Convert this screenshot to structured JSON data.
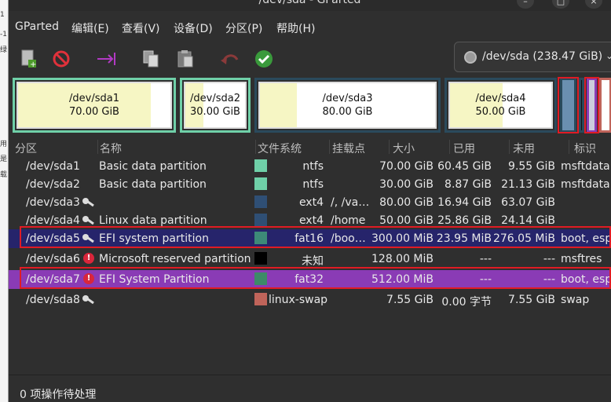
{
  "window": {
    "title": "/dev/sda - GParted"
  },
  "left_strip": [
    "1",
    "-1",
    "绿",
    "用",
    "是",
    "载"
  ],
  "menu": [
    "GParted",
    "编辑(E)",
    "查看(V)",
    "设备(D)",
    "分区(P)",
    "帮助(H)"
  ],
  "toolbar": {
    "buttons": [
      "new-icon",
      "delete-icon",
      "resize-move-icon",
      "copy-icon",
      "paste-icon",
      "undo-icon",
      "apply-icon"
    ]
  },
  "device": {
    "label": "/dev/sda  (238.47 GiB)"
  },
  "diskmap": [
    {
      "name": "/dev/sda1",
      "size": "70.00 GiB",
      "used_fraction": 0.87
    },
    {
      "name": "/dev/sda2",
      "size": "30.00 GiB",
      "used_fraction": 0.3
    },
    {
      "name": "/dev/sda3",
      "size": "80.00 GiB",
      "used_fraction": 0.21
    },
    {
      "name": "/dev/sda4",
      "size": "50.00 GiB",
      "used_fraction": 0.52
    }
  ],
  "columns": [
    "分区",
    "名称",
    "文件系统",
    "挂载点",
    "大小",
    "已用",
    "未用",
    "标识"
  ],
  "partitions": [
    {
      "partition": "/dev/sda1",
      "name": "Basic data partition",
      "fs": "ntfs",
      "fs_color": "#6fd0a8",
      "mount": "",
      "size": "70.00 GiB",
      "used": "60.45 GiB",
      "unused": "9.55 GiB",
      "flags": "msftdata",
      "icon": ""
    },
    {
      "partition": "/dev/sda2",
      "name": "Basic data partition",
      "fs": "ntfs",
      "fs_color": "#6fd0a8",
      "mount": "",
      "size": "30.00 GiB",
      "used": "8.87 GiB",
      "unused": "21.13 GiB",
      "flags": "msftdata",
      "icon": ""
    },
    {
      "partition": "/dev/sda3",
      "name": "",
      "fs": "ext4",
      "fs_color": "#2f4f75",
      "mount": "/, /va…",
      "size": "80.00 GiB",
      "used": "16.94 GiB",
      "unused": "63.07 GiB",
      "flags": "",
      "icon": "key"
    },
    {
      "partition": "/dev/sda4",
      "name": "Linux data partition",
      "fs": "ext4",
      "fs_color": "#2f4f75",
      "mount": "/home",
      "size": "50.00 GiB",
      "used": "25.86 GiB",
      "unused": "24.14 GiB",
      "flags": "",
      "icon": "key"
    },
    {
      "partition": "/dev/sda5",
      "name": "EFI system partition",
      "fs": "fat16",
      "fs_color": "#3d8a78",
      "mount": "/boo…",
      "size": "300.00 MiB",
      "used": "23.95 MiB",
      "unused": "276.05 MiB",
      "flags": "boot, esp",
      "icon": "key"
    },
    {
      "partition": "/dev/sda6",
      "name": "Microsoft reserved partition",
      "fs": "未知",
      "fs_color": "#000000",
      "mount": "",
      "size": "128.00 MiB",
      "used": "---",
      "unused": "---",
      "flags": "msftres",
      "icon": "warn"
    },
    {
      "partition": "/dev/sda7",
      "name": "EFI System Partition",
      "fs": "fat32",
      "fs_color": "#3d8a68",
      "mount": "",
      "size": "512.00 MiB",
      "used": "---",
      "unused": "---",
      "flags": "boot, esp",
      "icon": "warn"
    },
    {
      "partition": "/dev/sda8",
      "name": "",
      "fs": "linux-swap",
      "fs_color": "#c0645a",
      "mount": "",
      "size": "7.55 GiB",
      "used": "0.00 字节",
      "unused": "7.55 GiB",
      "flags": "swap",
      "icon": "key"
    }
  ],
  "status": "0 项操作待处理"
}
